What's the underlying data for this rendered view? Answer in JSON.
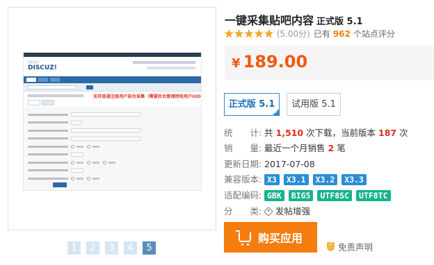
{
  "product": {
    "title": "一键采集贴吧内容",
    "version_label": "正式版 5.1"
  },
  "rating": {
    "stars": 5,
    "score": "(5.00分)",
    "has": "已有",
    "count": "962",
    "tail": "个站点评分"
  },
  "price": {
    "currency": "¥",
    "amount": "189.00"
  },
  "editions": {
    "pro": "正式版 5.1",
    "trial": "试用版 5.1"
  },
  "stats": {
    "downloads_key": "统　　计:",
    "downloads_pre": "共",
    "downloads_count": "1,510",
    "downloads_mid": "次下载，当前版本",
    "downloads_current": "187",
    "downloads_post": "次",
    "sales_key": "销　　量:",
    "sales_pre": "最近一个月销售",
    "sales_count": "2",
    "sales_post": "笔",
    "updated_key": "更新日期:",
    "updated_value": "2017-07-08",
    "compat_key": "兼容版本:",
    "compat_versions": [
      "X3",
      "X3.1",
      "X3.2",
      "X3.3"
    ],
    "encoding_key": "适配编码:",
    "encodings": [
      "GBK",
      "BIG5",
      "UTF8SC",
      "UTF8TC"
    ],
    "category_key": "分　　类:",
    "category_value": "发帖增强"
  },
  "actions": {
    "buy": "购买应用",
    "disclaimer": "免责声明"
  },
  "screenshot": {
    "logo": "DISCUZ!",
    "notice": "支持普通注册用户前台采集（需要后台管理授权用户UID）"
  },
  "thumbnails": [
    "1",
    "2",
    "3",
    "4",
    "5"
  ],
  "colors": {
    "price": "#f05a10",
    "buy_button": "#f57c0f",
    "accent_blue": "#2a8ed6",
    "accent_green": "#17b38d",
    "highlight_red": "#e02b1d"
  }
}
